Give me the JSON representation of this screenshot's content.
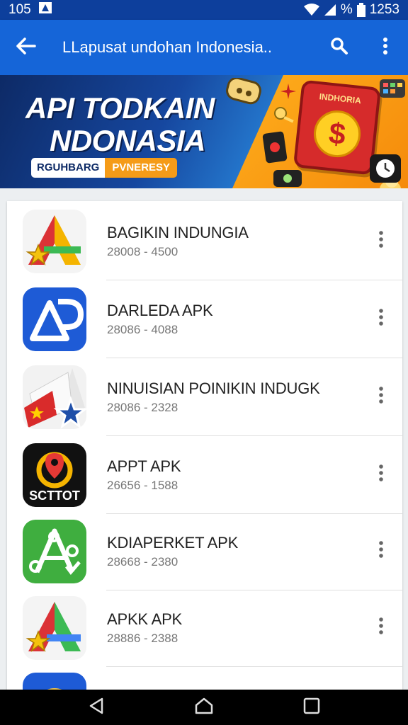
{
  "status_bar": {
    "time_left": "105",
    "battery_percent": "%",
    "time_right": "1253"
  },
  "app_bar": {
    "title": "LLapusat undohan Indonesia..",
    "icons": [
      "back-arrow-icon",
      "search-icon",
      "more-vert-icon"
    ]
  },
  "banner": {
    "title_line1": "API TODKAIN",
    "title_line2": "NDONASIA",
    "pill_left": "RGUHBARG",
    "pill_right": "PVNERESY",
    "wallet_label": "INDHORIA",
    "wallet_symbol": "$"
  },
  "apps": [
    {
      "title": "BAGIKIN INDUNGIA",
      "subtitle": "28008 - 4500",
      "icon": "triangle-star-icon"
    },
    {
      "title": "DARLEDA APK",
      "subtitle": "28086 - 4088",
      "icon": "ap-logo-icon"
    },
    {
      "title": "NINUISIAN POINIKIN INDUGK",
      "subtitle": "28086 - 2328",
      "icon": "flag-star-icon"
    },
    {
      "title": "APPT APK",
      "subtitle": "26656 - 1588",
      "icon": "map-pin-icon",
      "icon_text": "SCTTOT"
    },
    {
      "title": "KDIAPERKET APK",
      "subtitle": "28668 - 2380",
      "icon": "green-a-icon"
    },
    {
      "title": "APKK APK",
      "subtitle": "28886 - 2388",
      "icon": "triangle-star-icon"
    }
  ],
  "colors": {
    "status_bar": "#0d3f9c",
    "app_bar": "#1565d8",
    "accent_orange": "#f59b18"
  }
}
